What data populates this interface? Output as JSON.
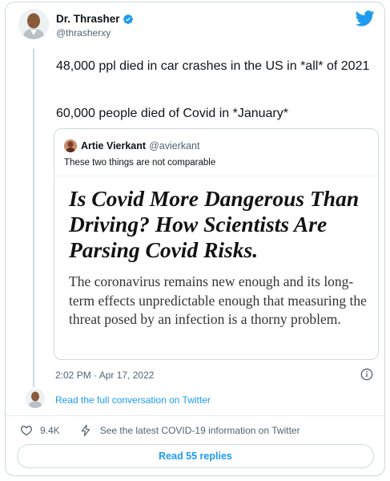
{
  "author": {
    "display_name": "Dr. Thrasher",
    "handle": "@thrasherxy"
  },
  "tweet": {
    "line1": "48,000 ppl died in car crashes in the US in *all* of 2021",
    "line2": "60,000 people died of Covid in *January*"
  },
  "quote": {
    "author_name": "Artie Vierkant",
    "author_handle": "@avierkant",
    "text": "These two things are not comparable",
    "media": {
      "headline": "Is Covid More Dangerous Than Driving? How Scientists Are Parsing Covid Risks.",
      "subhead": "The coronavirus remains new enough and its long-term effects unpredictable enough that measuring the threat posed by an infection is a thorny problem."
    }
  },
  "meta": {
    "timestamp": "2:02 PM · Apr 17, 2022"
  },
  "conversation_link": "Read the full conversation on Twitter",
  "actions": {
    "likes": "9.4K",
    "covid_info": "See the latest COVID-19 information on Twitter"
  },
  "replies_button": "Read 55 replies",
  "colors": {
    "accent": "#1d9bf0",
    "text": "#0f1419",
    "muted": "#536471",
    "border": "#cfd9de"
  },
  "icons": [
    "verified-badge-icon",
    "twitter-bird-icon",
    "info-icon",
    "heart-icon",
    "lightning-icon"
  ]
}
